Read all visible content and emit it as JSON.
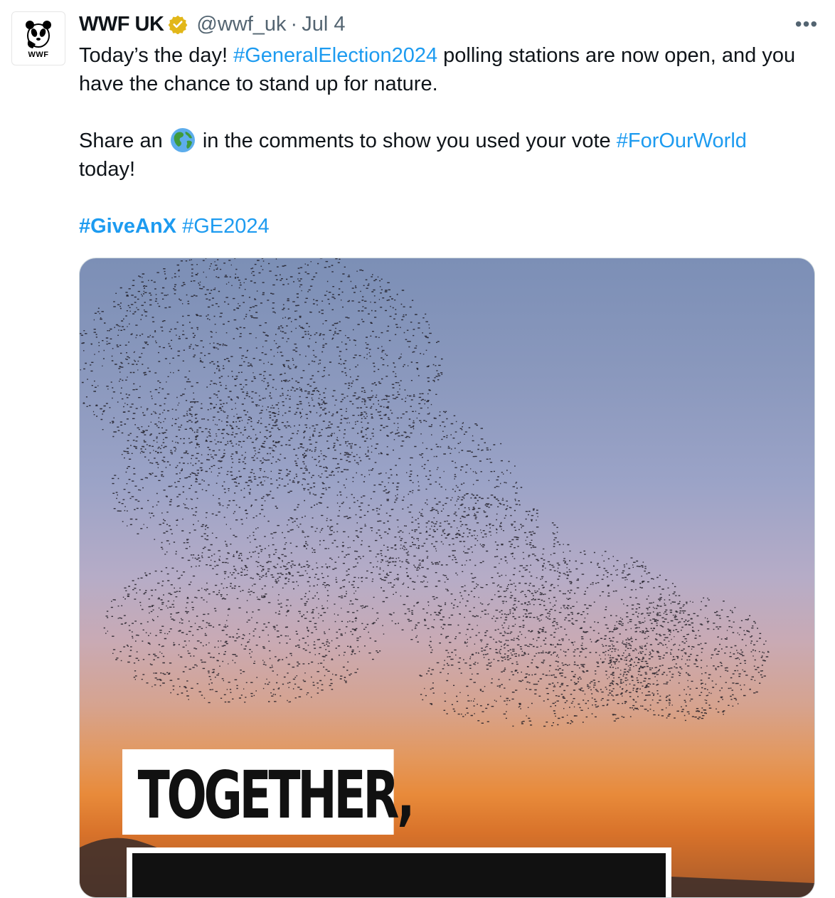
{
  "author": {
    "name": "WWF UK",
    "handle": "@wwf_uk",
    "separator": "·",
    "date": "Jul 4",
    "avatar_text": "WWF",
    "verified_icon": "verified-badge-icon"
  },
  "more_label": "•••",
  "tweet": {
    "line1_a": "Today’s the day! ",
    "line1_tag": "#GeneralElection2024",
    "line1_b": " polling stations are now open, and you have the chance to stand up for nature.",
    "line2_a": "Share an ",
    "line2_emoji": "globe-icon",
    "line2_b": " in the comments to show you used your vote ",
    "line2_tag": "#ForOurWorld",
    "line2_c": " today!",
    "tag3": "#GiveAnX",
    "tag4": "#GE2024"
  },
  "media": {
    "caption_line1": "TOGETHER,"
  },
  "colors": {
    "link": "#1d9bf0",
    "text": "#0f1419",
    "secondary": "#536471",
    "badge": "#e2b719"
  }
}
